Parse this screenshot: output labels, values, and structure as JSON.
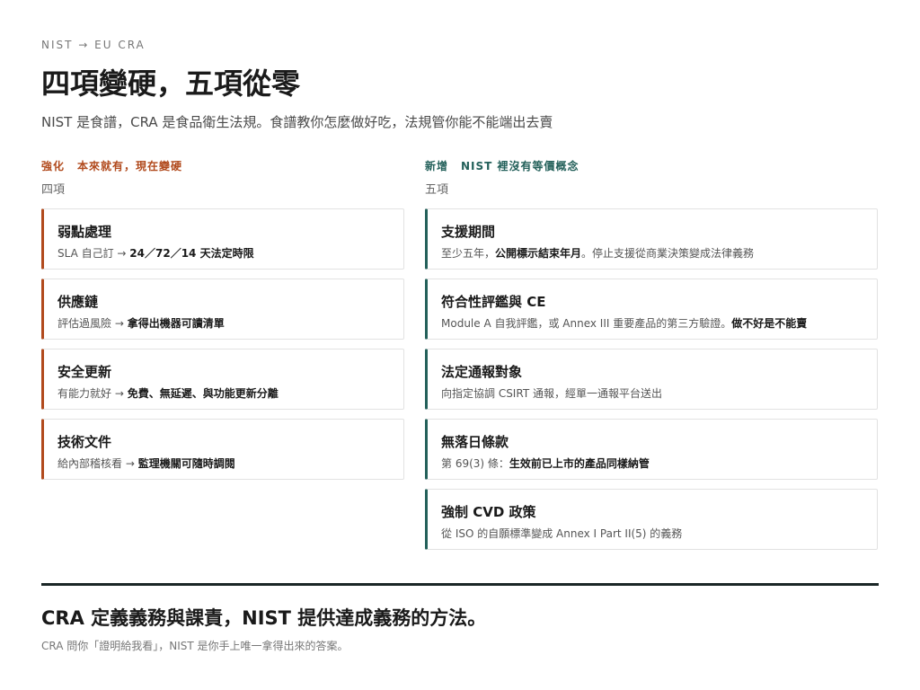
{
  "header": {
    "eyebrow": "NIST → EU CRA",
    "title": "四項變硬，五項從零",
    "subtitle": "NIST 是食譜，CRA 是食品衛生法規。食譜教你怎麼做好吃，法規管你能不能端出去賣"
  },
  "left": {
    "tag": "強化",
    "heading": "本來就有，現在變硬",
    "count": "四項",
    "items": [
      {
        "title": "弱點處理",
        "desc_plain": "SLA 自己訂 → ",
        "desc_bold": "24／72／14 天法定時限"
      },
      {
        "title": "供應鏈",
        "desc_plain": "評估過風險 → ",
        "desc_bold": "拿得出機器可讀清單"
      },
      {
        "title": "安全更新",
        "desc_plain": "有能力就好 → ",
        "desc_bold": "免費、無延遲、與功能更新分離"
      },
      {
        "title": "技術文件",
        "desc_plain": "給內部稽核看 → ",
        "desc_bold": "監理機關可隨時調閱"
      }
    ]
  },
  "right": {
    "tag": "新增",
    "heading": "NIST 裡沒有等價概念",
    "count": "五項",
    "items": [
      {
        "title": "支援期間",
        "pre": "至少五年，",
        "bold": "公開標示結束年月",
        "post": "。停止支援從商業決策變成法律義務"
      },
      {
        "title": "符合性評鑑與 CE",
        "pre": "Module A 自我評鑑，或 Annex III 重要產品的第三方驗證。",
        "bold": "做不好是不能賣",
        "post": ""
      },
      {
        "title": "法定通報對象",
        "pre": "向指定協調 CSIRT 通報，經單一通報平台送出",
        "bold": "",
        "post": ""
      },
      {
        "title": "無落日條款",
        "pre": "第 69(3) 條：",
        "bold": "生效前已上市的產品同樣納管",
        "post": ""
      },
      {
        "title": "強制 CVD 政策",
        "pre": "從 ISO 的自願標準變成 Annex I Part II(5) 的義務",
        "bold": "",
        "post": ""
      }
    ]
  },
  "footer": {
    "title": "CRA 定義義務與課責，NIST 提供達成義務的方法。",
    "note": "CRA 問你「證明給我看」，NIST 是你手上唯一拿得出來的答案。"
  },
  "colors": {
    "accent_strengthen": "#b14a1d",
    "accent_new": "#23605a",
    "rule": "#1a2626"
  }
}
